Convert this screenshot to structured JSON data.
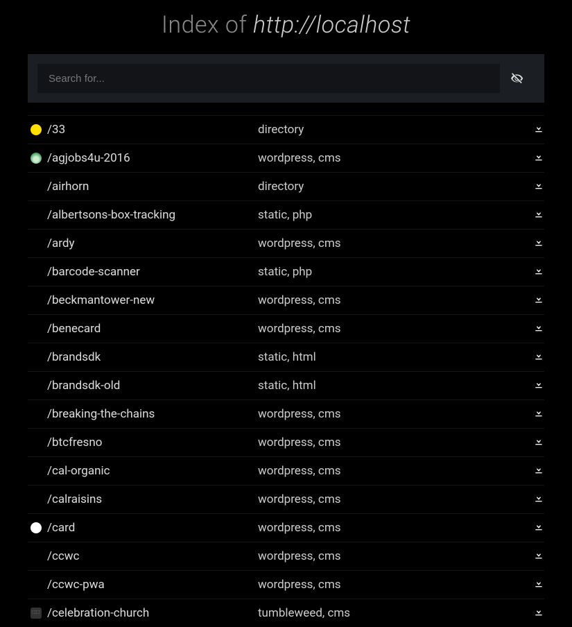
{
  "header": {
    "prefix": "Index of ",
    "url": "http://localhost"
  },
  "search": {
    "placeholder": "Search for..."
  },
  "rows": [
    {
      "fav": "smile",
      "name": "/33",
      "type": "directory"
    },
    {
      "fav": "green",
      "name": "/agjobs4u-2016",
      "type": "wordpress, cms"
    },
    {
      "fav": "",
      "name": "/airhorn",
      "type": "directory"
    },
    {
      "fav": "",
      "name": "/albertsons-box-tracking",
      "type": "static, php"
    },
    {
      "fav": "",
      "name": "/ardy",
      "type": "wordpress, cms"
    },
    {
      "fav": "",
      "name": "/barcode-scanner",
      "type": "static, php"
    },
    {
      "fav": "",
      "name": "/beckmantower-new",
      "type": "wordpress, cms"
    },
    {
      "fav": "",
      "name": "/benecard",
      "type": "wordpress, cms"
    },
    {
      "fav": "",
      "name": "/brandsdk",
      "type": "static, html"
    },
    {
      "fav": "",
      "name": "/brandsdk-old",
      "type": "static, html"
    },
    {
      "fav": "",
      "name": "/breaking-the-chains",
      "type": "wordpress, cms"
    },
    {
      "fav": "",
      "name": "/btcfresno",
      "type": "wordpress, cms"
    },
    {
      "fav": "",
      "name": "/cal-organic",
      "type": "wordpress, cms"
    },
    {
      "fav": "",
      "name": "/calraisins",
      "type": "wordpress, cms"
    },
    {
      "fav": "card",
      "name": "/card",
      "type": "wordpress, cms"
    },
    {
      "fav": "",
      "name": "/ccwc",
      "type": "wordpress, cms"
    },
    {
      "fav": "",
      "name": "/ccwc-pwa",
      "type": "wordpress, cms"
    },
    {
      "fav": "church",
      "name": "/celebration-church",
      "type": "tumbleweed, cms"
    }
  ]
}
